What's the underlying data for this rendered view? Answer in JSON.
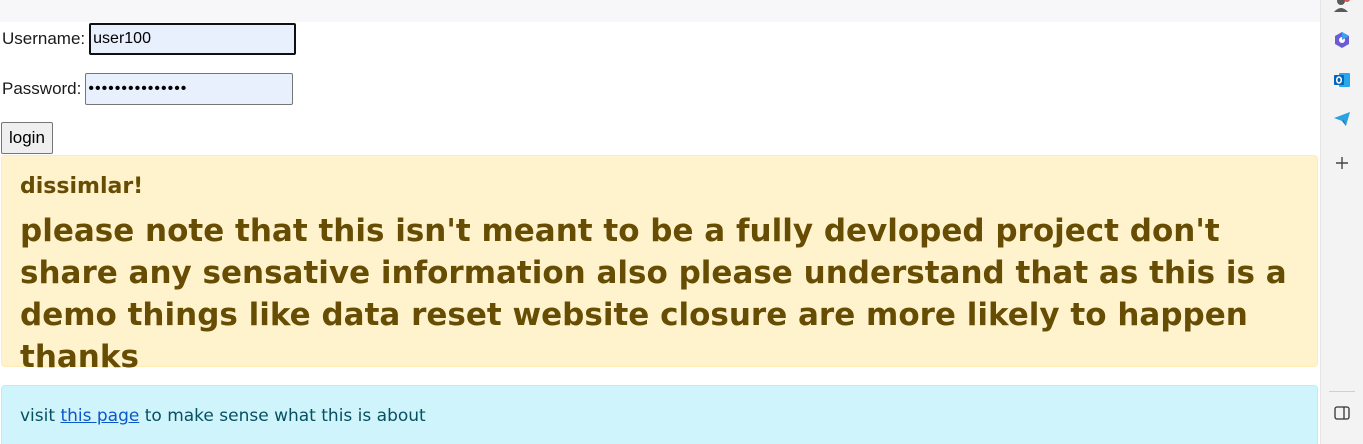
{
  "login": {
    "username_label": "Username:",
    "username_value": "user100",
    "password_label": "Password:",
    "password_value": "•••••••••••••••",
    "button_label": "login"
  },
  "warning": {
    "heading": "dissimlar!",
    "body": "please note that this isn't meant to be a fully devloped project don't share any sensative information also please understand that as this is a demo things like data reset website closure are more likely to happen thanks"
  },
  "info": {
    "prefix": "visit ",
    "link_text": "this page",
    "suffix": " to make sense what this is about"
  },
  "sidebar": {
    "icons": [
      "profile-icon",
      "copilot-icon",
      "outlook-icon",
      "telegram-icon",
      "add-icon",
      "split-screen-icon"
    ]
  },
  "colors": {
    "warning_bg": "#fff3cd",
    "warning_text": "#664d03",
    "info_bg": "#cff4fc",
    "link": "#0a58ca"
  }
}
